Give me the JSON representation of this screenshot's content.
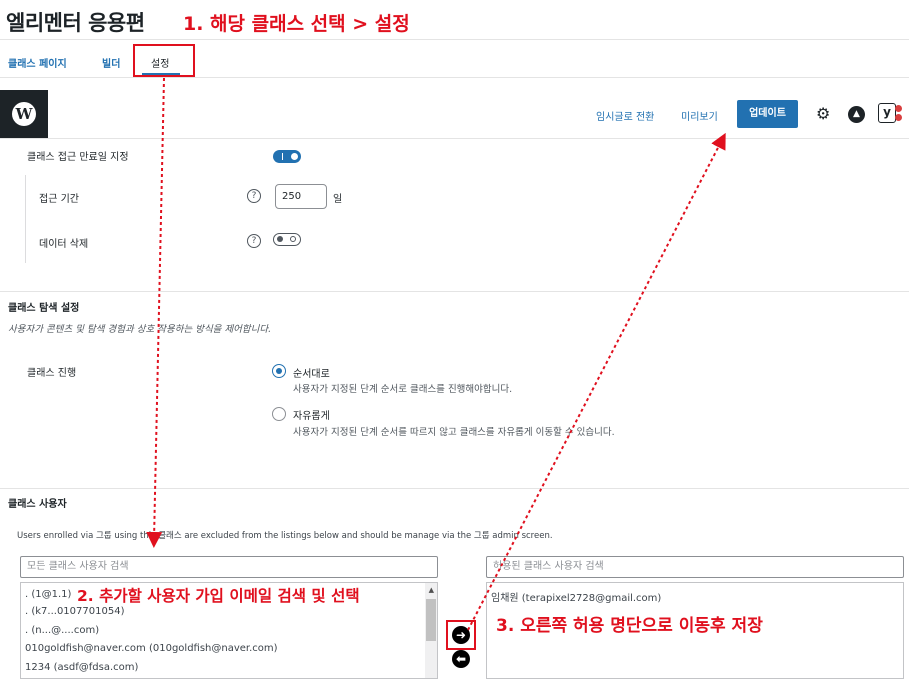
{
  "page": {
    "title": "엘리멘터 응용편"
  },
  "annotations": {
    "step1": "1. 해당 클래스 선택 > 설정",
    "step2": "2. 추가할 사용자 가입 이메일 검색 및 선택",
    "step3": "3. 오른쪽 허용 명단으로 이동후 저장"
  },
  "tabs": [
    {
      "label": "클래스 페이지"
    },
    {
      "label": "빌더"
    },
    {
      "label": "설정",
      "active": true
    }
  ],
  "header": {
    "logo_letter": "W",
    "draft_link": "임시글로 전환",
    "preview_link": "미리보기",
    "update_button": "업데이트",
    "icons": [
      "wordpress-icon",
      "gear-icon",
      "astra-icon",
      "yoast-icon"
    ]
  },
  "access": {
    "expiry_label": "클래스 접근 만료일 지정",
    "expiry_enabled": true,
    "period_label": "접근 기간",
    "period_value": "250",
    "period_unit": "일",
    "delete_label": "데이터 삭제",
    "delete_enabled": false,
    "help_glyph": "?"
  },
  "navigation": {
    "title": "클래스 탐색 설정",
    "description": "사용자가 콘텐츠 및 탐색 경험과 상호 작용하는 방식을 제어합니다.",
    "progress_label": "클래스 진행",
    "options": [
      {
        "label": "순서대로",
        "description": "사용자가 지정된 단계 순서로 클래스를 진행해야합니다.",
        "selected": true
      },
      {
        "label": "자유롭게",
        "description": "사용자가 지정된 단계 순서를 따르지 않고 클래스를 자유롭게 이동할 수 있습니다.",
        "selected": false
      }
    ]
  },
  "users": {
    "title": "클래스 사용자",
    "note": "Users enrolled via 그룹 using this 클래스 are excluded from the listings below and should be manage via the 그룹 admin screen.",
    "all_search_placeholder": "모든 클래스 사용자 검색",
    "allowed_search_placeholder": "허용된 클래스 사용자 검색",
    "all_users": [
      ". (1@1.1)",
      ". (k7...0107701054)",
      ". (n...@....com)",
      "010goldfish@naver.com (010goldfish@naver.com)",
      "1234 (asdf@fdsa.com)"
    ],
    "allowed_users": [
      "임채원 (terapixel2728@gmail.com)"
    ],
    "move_right_glyph": "➜",
    "move_left_glyph": "⬅"
  },
  "colors": {
    "accent": "#2271b1",
    "annotation_red": "#e0101e"
  }
}
